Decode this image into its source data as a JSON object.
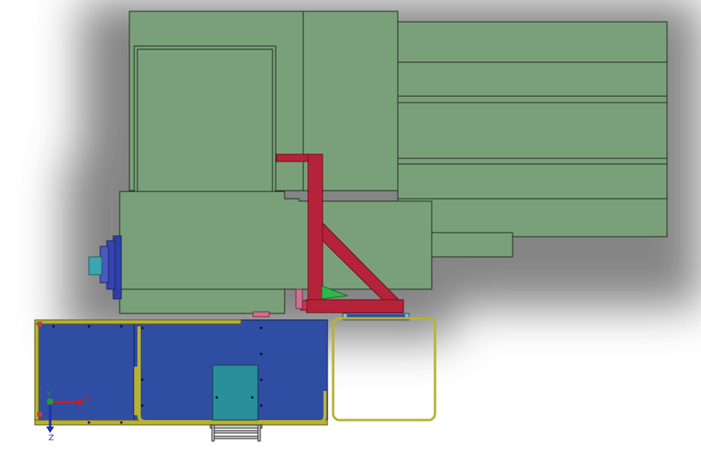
{
  "viewport": {
    "background": "#ffffff",
    "shadow_color": "#6f6f6f"
  },
  "colors": {
    "machine_body": "#7aa07a",
    "machine_edge": "#1e2a1e",
    "frame_red": "#b5233a",
    "frame_red_dark": "#6e0f1c",
    "panel_blue": "#2f4da3",
    "panel_teal": "#2a8f9a",
    "rail_yellow": "#b8b233",
    "spindle_teal": "#3aa6b0",
    "spindle_blue": "#2c3fa6",
    "bracket_green": "#2fb84a"
  },
  "triad": {
    "x_label": "X",
    "y_label": "Y",
    "z_label": "Z",
    "x_color": "#c0202a",
    "y_color": "#1f9a3a",
    "z_color": "#2030b0"
  }
}
